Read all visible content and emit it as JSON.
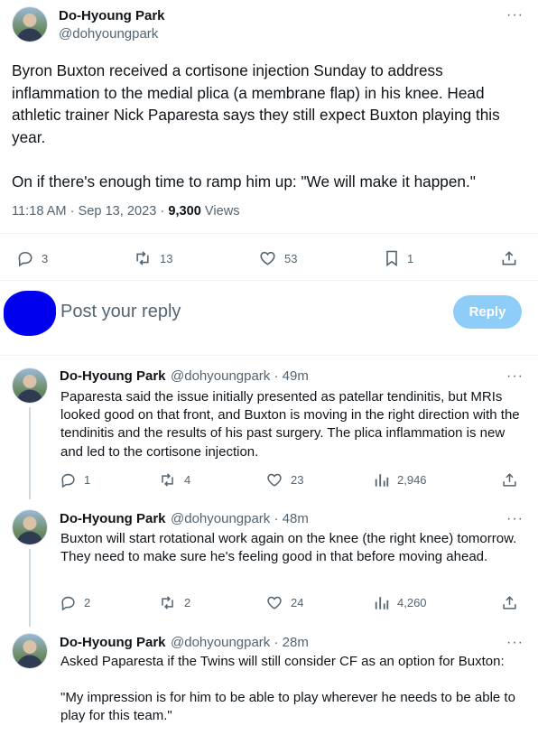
{
  "main_tweet": {
    "author_name": "Do-Hyoung Park",
    "author_handle": "@dohyoungpark",
    "text_p1": "Byron Buxton received a cortisone injection Sunday to address inflammation to the medial plica (a membrane flap) in his knee. Head athletic trainer Nick Paparesta says they still expect Buxton playing this year.",
    "text_p2": "On if there's enough time to ramp him up: \"We will make it happen.\"",
    "timestamp": "11:18 AM · Sep 13, 2023 · ",
    "views_count": "9,300",
    "views_label": " Views",
    "replies": "3",
    "retweets": "13",
    "likes": "53",
    "bookmarks": "1"
  },
  "compose": {
    "placeholder": "Post your reply",
    "button_label": "Reply"
  },
  "replies": [
    {
      "author_name": "Do-Hyoung Park",
      "author_handle": "@dohyoungpark · 49m",
      "text_p1": "Paparesta said the issue initially presented as patellar tendinitis, but MRIs looked good on that front, and Buxton is moving in the right direction with the tendinitis and the results of his past surgery. The plica inflammation is new and led to the cortisone injection.",
      "replies": "1",
      "retweets": "4",
      "likes": "23",
      "views": "2,946"
    },
    {
      "author_name": "Do-Hyoung Park",
      "author_handle": "@dohyoungpark · 48m",
      "text_p1": "Buxton will start rotational work again on the knee (the right knee) tomorrow. They need to make sure he's feeling good in that before moving ahead.",
      "replies": "2",
      "retweets": "2",
      "likes": "24",
      "views": "4,260"
    },
    {
      "author_name": "Do-Hyoung Park",
      "author_handle": "@dohyoungpark · 28m",
      "text_p1": "Asked Paparesta if the Twins will still consider CF as an option for Buxton:",
      "text_p2": "\"My impression is for him to be able to play wherever he needs to be able to play for this team.\""
    }
  ],
  "icons": {
    "more": "more-horizontal-icon",
    "reply": "reply-bubble-icon",
    "retweet": "retweet-icon",
    "like": "heart-icon",
    "bookmark": "bookmark-icon",
    "share": "share-upload-icon",
    "views": "analytics-bars-icon"
  },
  "colors": {
    "text": "#0f1419",
    "secondary": "#536471",
    "reply_button": "#8ecdf8",
    "redaction": "#0000ee",
    "divider": "#eff3f4"
  }
}
